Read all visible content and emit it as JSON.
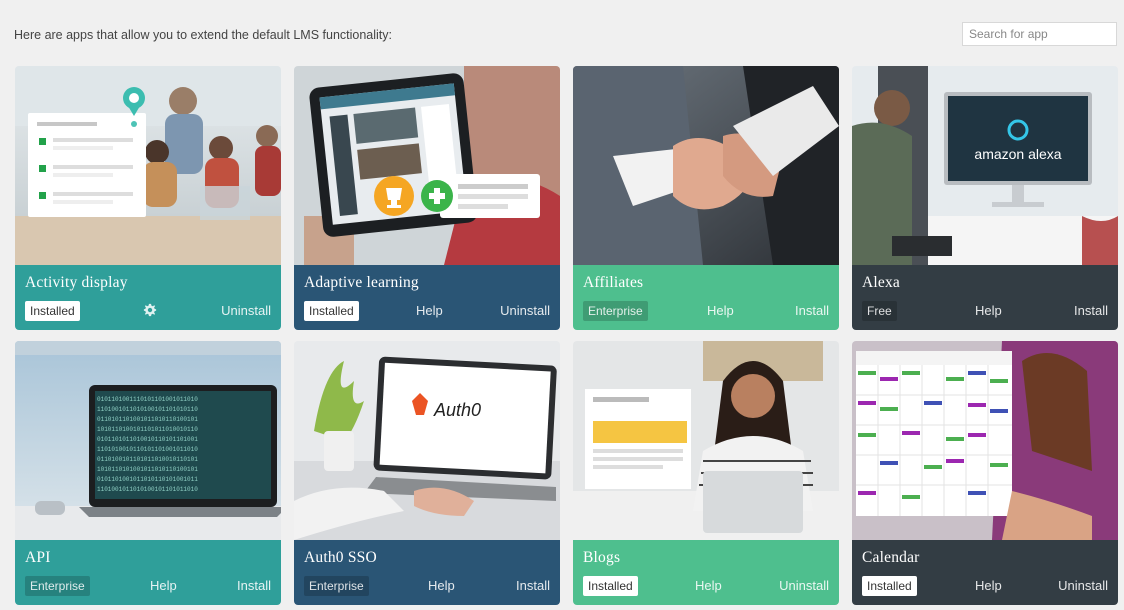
{
  "header": {
    "intro_text": "Here are apps that allow you to extend the default LMS functionality:",
    "search_placeholder": "Search for app"
  },
  "apps": [
    {
      "title": "Activity display",
      "badge": "Installed",
      "help": "",
      "settings_icon": "gear-icon",
      "action": "Uninstall",
      "color": "#2f9f9a"
    },
    {
      "title": "Adaptive learning",
      "badge": "Installed",
      "help": "Help",
      "action": "Uninstall",
      "color": "#2a5575"
    },
    {
      "title": "Affiliates",
      "badge": "Enterprise",
      "help": "Help",
      "action": "Install",
      "color": "#4ebf8e"
    },
    {
      "title": "Alexa",
      "badge": "Free",
      "help": "Help",
      "action": "Install",
      "color": "#333d44"
    },
    {
      "title": "API",
      "badge": "Enterprise",
      "help": "Help",
      "action": "Install",
      "color": "#2f9f9a"
    },
    {
      "title": "Auth0 SSO",
      "badge": "Enterprise",
      "help": "Help",
      "action": "Install",
      "color": "#2a5575"
    },
    {
      "title": "Blogs",
      "badge": "Installed",
      "help": "Help",
      "action": "Uninstall",
      "color": "#4ebf8e"
    },
    {
      "title": "Calendar",
      "badge": "Installed",
      "help": "Help",
      "action": "Uninstall",
      "color": "#333d44"
    }
  ],
  "artwork_text": {
    "alexa": "amazon alexa",
    "auth0": "Auth0"
  }
}
